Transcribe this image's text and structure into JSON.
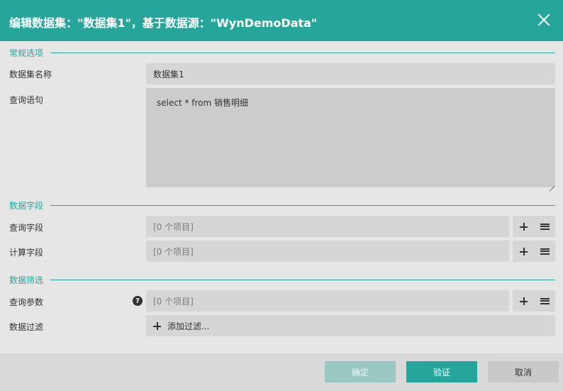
{
  "dialog": {
    "title": "编辑数据集：\"数据集1\"，基于数据源：\"WynDemoData\""
  },
  "sections": {
    "general": "常规选项",
    "fields": "数据字段",
    "filters": "数据筛选"
  },
  "general": {
    "name_label": "数据集名称",
    "name_value": "数据集1",
    "query_label": "查询语句",
    "query_value": "select * from 销售明细"
  },
  "fields": {
    "query_fields_label": "查询字段",
    "query_fields_value": "[0 个项目]",
    "calc_fields_label": "计算字段",
    "calc_fields_value": "[0 个项目]"
  },
  "filters": {
    "params_label": "查询参数",
    "params_value": "[0 个项目]",
    "help_glyph": "?",
    "filter_label": "数据过滤",
    "add_filter": "添加过滤..."
  },
  "footer": {
    "ok": "确定",
    "verify": "验证",
    "cancel": "取消"
  },
  "colors": {
    "accent": "#26a69a",
    "background": "#e6e6e6",
    "field": "#d6d6d6",
    "ok_disabled": "#9ac8c3"
  },
  "icons": {
    "close": "close-icon",
    "add": "plus-icon",
    "menu": "menu-icon",
    "help": "help-icon"
  }
}
